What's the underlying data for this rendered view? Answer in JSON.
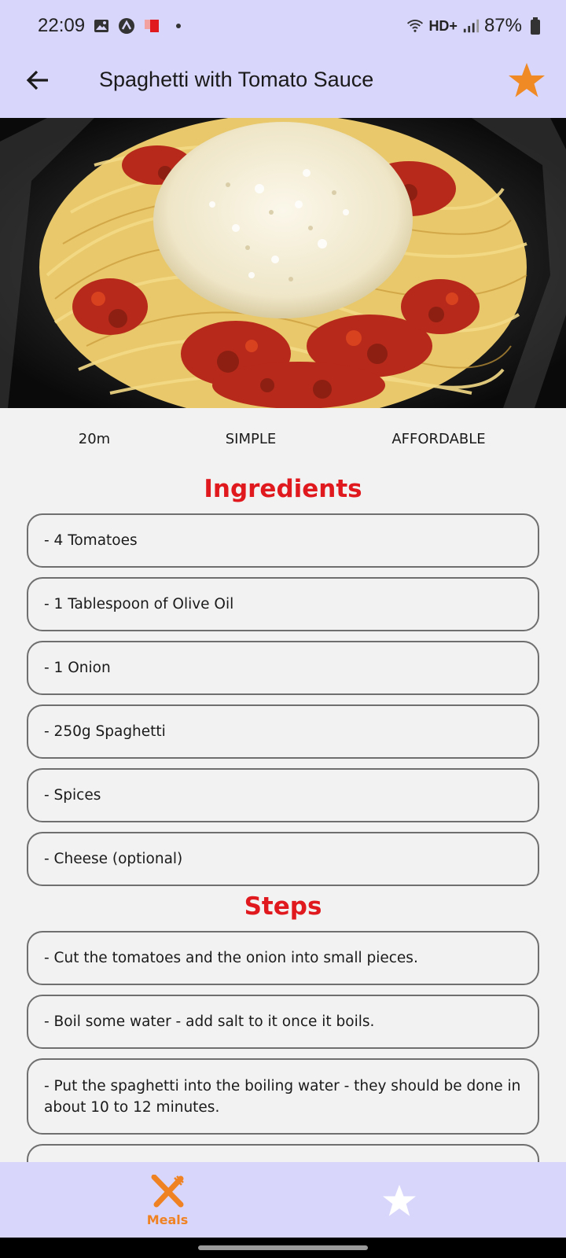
{
  "status_bar": {
    "time": "22:09",
    "network": "HD+",
    "battery": "87%"
  },
  "app_bar": {
    "title": "Spaghetti with Tomato Sauce",
    "back_icon": "arrow-left-icon",
    "favorite_icon": "star-icon",
    "accent_color": "#f08a24"
  },
  "meal": {
    "duration": "20m",
    "complexity": "SIMPLE",
    "affordability": "AFFORDABLE"
  },
  "ingredients": {
    "title": "Ingredients",
    "items": [
      "- 4 Tomatoes",
      "- 1 Tablespoon of Olive Oil",
      "- 1 Onion",
      "- 250g Spaghetti",
      "- Spices",
      "- Cheese (optional)"
    ]
  },
  "steps": {
    "title": "Steps",
    "items": [
      "- Cut the tomatoes and the onion into small pieces.",
      "- Boil some water - add salt to it once it boils.",
      "- Put the spaghetti into the boiling water - they should be done in about 10 to 12 minutes.",
      ""
    ]
  },
  "bottom_nav": {
    "meals_label": "Meals",
    "meals_icon": "fork-knife-icon",
    "favorites_icon": "star-icon",
    "active_color": "#ef8323",
    "inactive_color": "#ffffff"
  },
  "colors": {
    "bar_background": "#d9d6fb",
    "section_title": "#e0191e",
    "page_background": "#f2f2f2"
  }
}
